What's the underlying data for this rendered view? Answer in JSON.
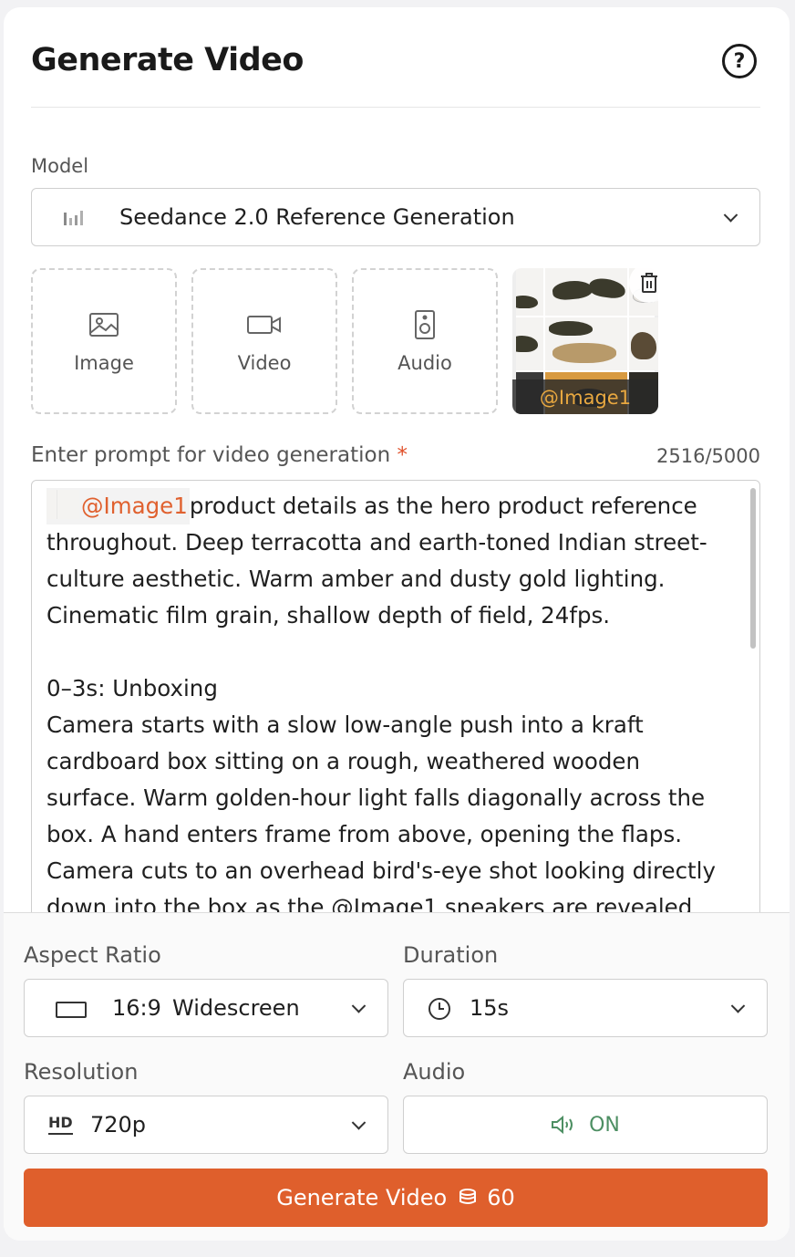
{
  "header": {
    "title": "Generate Video",
    "help_icon": "question-circle-icon"
  },
  "model": {
    "label": "Model",
    "selected": "Seedance 2.0 Reference Generation",
    "icon": "signal-bars-icon"
  },
  "uploads": [
    {
      "label": "Image",
      "icon": "image-icon"
    },
    {
      "label": "Video",
      "icon": "video-camera-icon"
    },
    {
      "label": "Audio",
      "icon": "speaker-icon"
    }
  ],
  "reference": {
    "tag": "@Image1",
    "delete_icon": "trash-icon"
  },
  "prompt": {
    "label": "Enter prompt for video generation",
    "required_mark": "*",
    "counter": "2516/5000",
    "mention": "@Image1",
    "text": "product details as the hero product reference throughout. Deep terracotta and earth-toned Indian street-culture aesthetic. Warm amber and dusty gold lighting. Cinematic film grain, shallow depth of field, 24fps.\n\n0–3s: Unboxing\nCamera starts with a slow low-angle push into a kraft cardboard box sitting on a rough, weathered wooden surface. Warm golden-hour light falls diagonally across the box. A hand enters frame from above, opening the flaps. Camera cuts to an overhead bird's-eye shot looking directly down into the box as the @Image1 sneakers are revealed"
  },
  "settings": {
    "aspect_ratio": {
      "label": "Aspect Ratio",
      "ratio": "16:9",
      "name": "Widescreen",
      "icon": "rectangle-icon"
    },
    "duration": {
      "label": "Duration",
      "value": "15s",
      "icon": "clock-icon"
    },
    "resolution": {
      "label": "Resolution",
      "value": "720p",
      "icon": "hd-icon",
      "icon_text": "HD"
    },
    "audio": {
      "label": "Audio",
      "value": "ON",
      "icon": "speaker-wave-icon"
    }
  },
  "generate": {
    "label": "Generate Video",
    "cost": "60",
    "icon": "coins-icon"
  },
  "colors": {
    "accent": "#df5f2c",
    "audio_on": "#4d8f63",
    "mention": "#e0612f"
  }
}
